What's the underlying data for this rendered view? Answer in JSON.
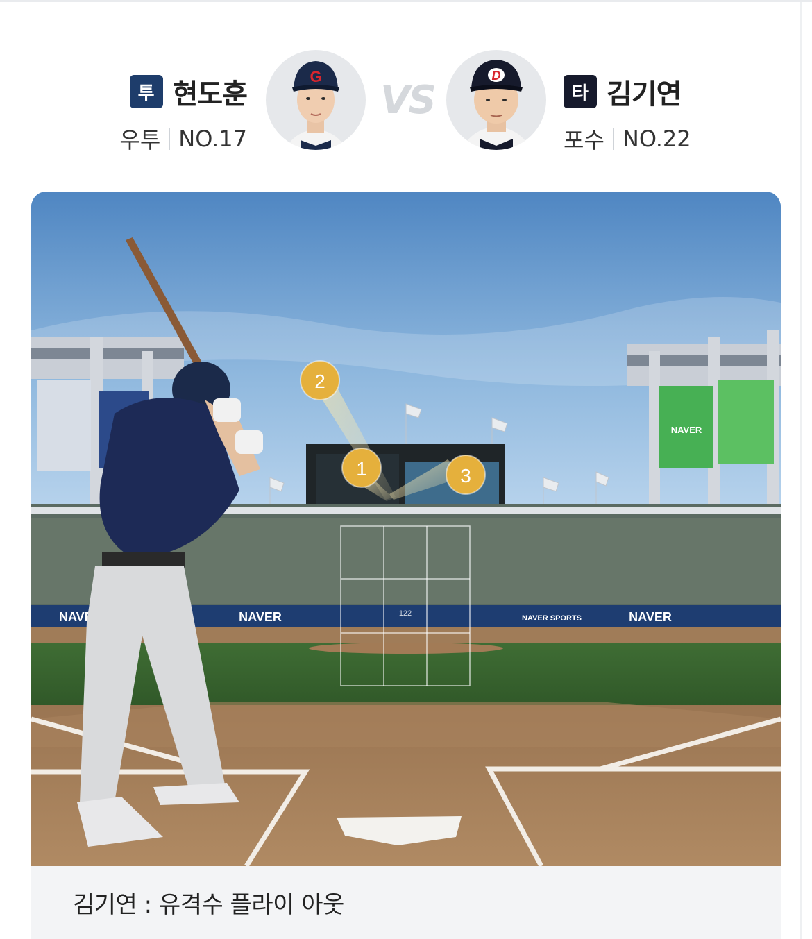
{
  "pitcher": {
    "badge": "투",
    "name": "현도훈",
    "throw_type": "우투",
    "number": "NO.17",
    "cap_letter": "G",
    "team_color": "#1b2a4a"
  },
  "vs_label": "VS",
  "batter": {
    "badge": "타",
    "name": "김기연",
    "position": "포수",
    "number": "NO.22",
    "cap_letter": "D",
    "team_color": "#161a2c"
  },
  "field": {
    "sponsor_text": "NAVER",
    "sponsor_sports_text": "NAVER SPORTS",
    "pitch_speed": "122",
    "pitches": [
      {
        "number": "1"
      },
      {
        "number": "2"
      },
      {
        "number": "3"
      }
    ],
    "pitch_marker_color": "#e5b03c"
  },
  "result": {
    "text": "김기연 : 유격수 플라이 아웃"
  }
}
